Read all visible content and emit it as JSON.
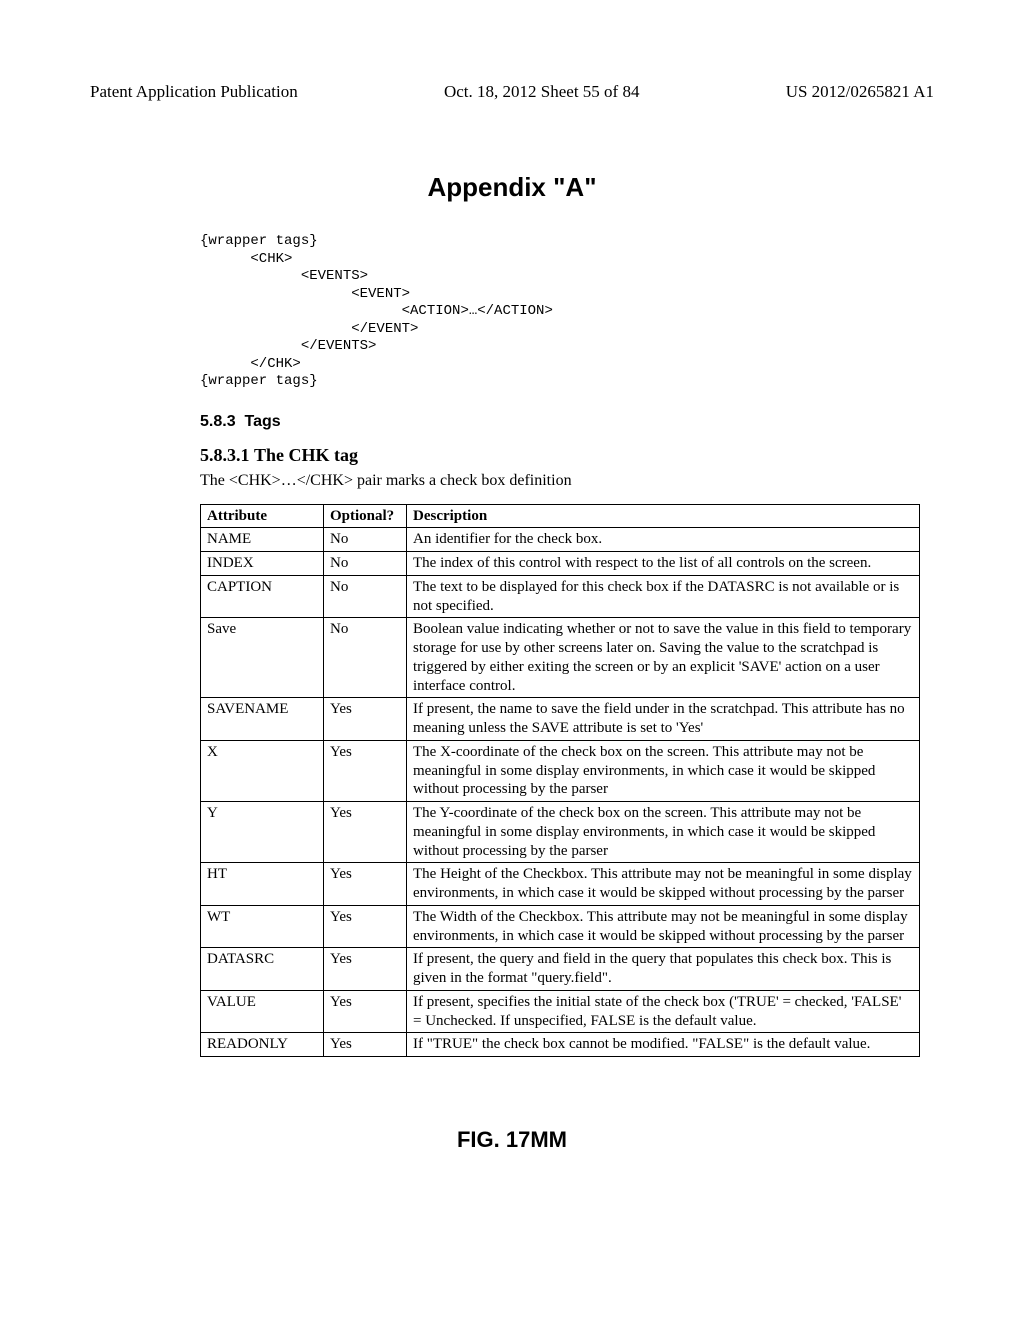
{
  "header": {
    "left": "Patent Application Publication",
    "mid": "Oct. 18, 2012  Sheet 55 of 84",
    "right": "US 2012/0265821 A1"
  },
  "appendix_title": "Appendix \"A\"",
  "code_block": "{wrapper tags}\n      <CHK>\n            <EVENTS>\n                  <EVENT>\n                        <ACTION>…</ACTION>\n                  </EVENT>\n            </EVENTS>\n      </CHK>\n{wrapper tags}",
  "section1": {
    "num": "5.8.3",
    "title": "Tags"
  },
  "section2": {
    "num": "5.8.3.1",
    "title": "The CHK tag"
  },
  "section2_para": "The <CHK>…</CHK> pair marks a check box definition",
  "table": {
    "headers": [
      "Attribute",
      "Optional?",
      "Description"
    ],
    "rows": [
      {
        "attr": "NAME",
        "opt": "No",
        "desc": "An identifier for the check box."
      },
      {
        "attr": "INDEX",
        "opt": "No",
        "desc": "The index of this control with respect to the list of all controls on the screen."
      },
      {
        "attr": "CAPTION",
        "opt": "No",
        "desc": "The text to be displayed for this check box if the DATASRC is not available or is not specified."
      },
      {
        "attr": "Save",
        "opt": "No",
        "desc": "Boolean value indicating whether or not to save the value in this field to temporary storage for use by other screens later on. Saving the value to the scratchpad is triggered by either exiting the screen or by an explicit 'SAVE' action on a user interface control."
      },
      {
        "attr": "SAVENAME",
        "opt": "Yes",
        "desc": "If present, the name to save the field under in the scratchpad. This attribute has no meaning unless the SAVE attribute is set to 'Yes'"
      },
      {
        "attr": "X",
        "opt": "Yes",
        "desc": "The X-coordinate of the check box on the screen. This attribute may not be meaningful in some display environments, in which case it would be skipped without processing by the parser"
      },
      {
        "attr": "Y",
        "opt": "Yes",
        "desc": "The Y-coordinate of the check box on the screen. This attribute may not be meaningful in some display environments, in which case it would be skipped without processing by the parser"
      },
      {
        "attr": "HT",
        "opt": "Yes",
        "desc": "The Height of the Checkbox. This attribute may not be meaningful in some display environments, in which case it would be skipped without processing by the parser"
      },
      {
        "attr": "WT",
        "opt": "Yes",
        "desc": "The Width of the Checkbox. This attribute may not be meaningful in some display environments, in which case it would be skipped without processing by the parser"
      },
      {
        "attr": "DATASRC",
        "opt": "Yes",
        "desc": "If present, the query and field in the query that populates this check box. This is given in the format \"query.field\"."
      },
      {
        "attr": "VALUE",
        "opt": "Yes",
        "desc": "If present, specifies the initial state of the check box ('TRUE' = checked, 'FALSE' = Unchecked. If unspecified, FALSE is the default value."
      },
      {
        "attr": "READONLY",
        "opt": "Yes",
        "desc": "If \"TRUE\" the check box cannot be modified. \"FALSE\" is the default value."
      }
    ]
  },
  "figure_caption": "FIG. 17MM"
}
